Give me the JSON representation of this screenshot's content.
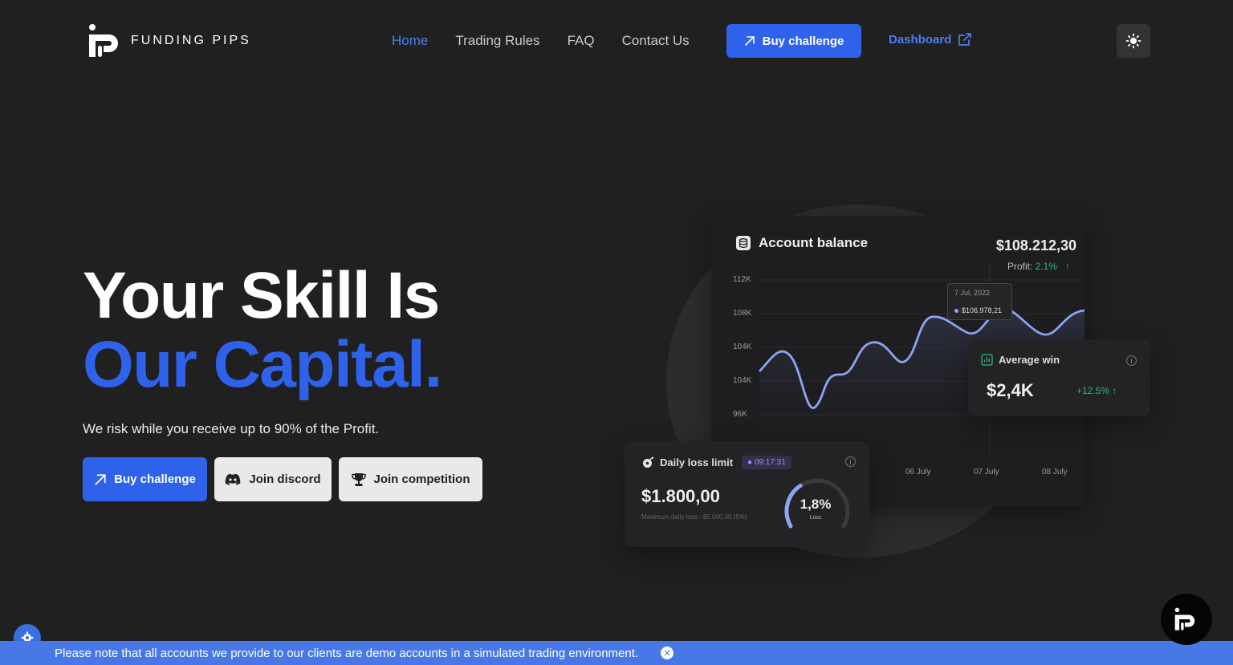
{
  "brand": {
    "name": "FUNDING PIPS"
  },
  "nav": {
    "items": [
      {
        "label": "Home",
        "active": true
      },
      {
        "label": "Trading Rules",
        "active": false
      },
      {
        "label": "FAQ",
        "active": false
      },
      {
        "label": "Contact Us",
        "active": false
      }
    ],
    "buy_label": "Buy challenge",
    "dashboard_label": "Dashboard",
    "theme_icon": "sun-icon"
  },
  "hero": {
    "title_line1": "Your Skill Is",
    "title_line2": "Our Capital.",
    "subtitle": "We risk while you receive up to 90% of the Profit.",
    "buttons": {
      "buy": "Buy challenge",
      "discord": "Join discord",
      "competition": "Join competition"
    }
  },
  "account_card": {
    "title": "Account balance",
    "value": "$108.212,30",
    "profit_label": "Profit:",
    "profit_value": "2.1%",
    "y_ticks": [
      "112K",
      "108K",
      "104K",
      "104K",
      "96K"
    ],
    "x_ticks": [
      "06 July",
      "07 July",
      "08 July"
    ],
    "tooltip": {
      "date": "7 Jul, 2022",
      "value": "$106.978,21"
    }
  },
  "average_win": {
    "title": "Average win",
    "value": "$2,4K",
    "change": "+12.5%"
  },
  "daily_loss": {
    "title": "Daily loss limit",
    "timer": "09:17:31",
    "value": "$1.800,00",
    "subtext": "Maximum daily loss: -$5.000,00 (5%)",
    "gauge_percent": "1,8%",
    "gauge_label": "Loss",
    "gauge_fraction": 0.36
  },
  "notice": {
    "text": "Please note that all accounts we provide to our clients are demo accounts in a simulated trading environment."
  },
  "colors": {
    "accent": "#2f62ea",
    "background": "#202021",
    "profit": "#2eb876",
    "notice": "#4878e6"
  }
}
